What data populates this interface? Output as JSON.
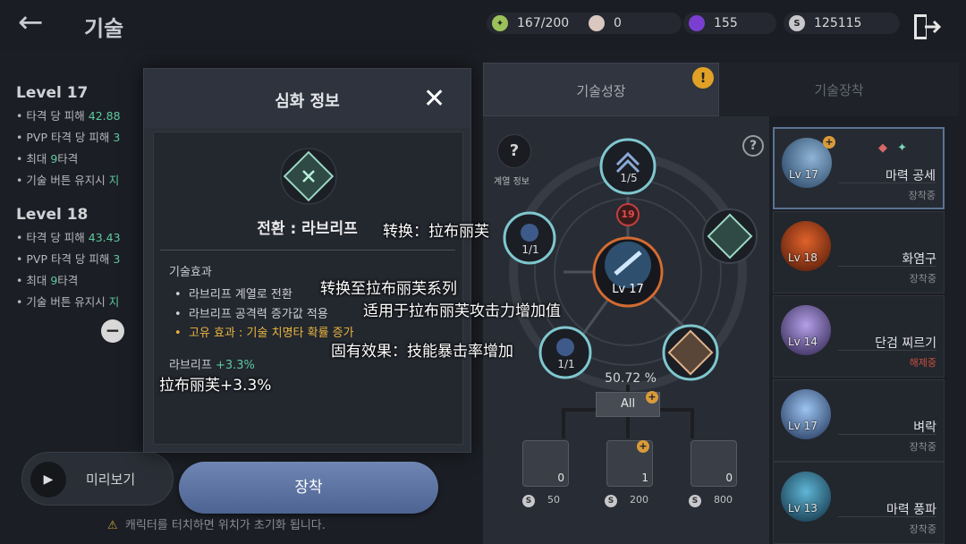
{
  "header": {
    "back_icon": "back-arrow-icon",
    "title": "기술",
    "resources": [
      {
        "icon": "stamina-icon",
        "value": "167/200",
        "color": "#9bc25a"
      },
      {
        "icon": "pearl-icon",
        "value": "0",
        "color": "#d9c7c0"
      },
      {
        "icon": "purple-gem-icon",
        "value": "155",
        "color": "#7a3fd1"
      },
      {
        "icon": "silver-coin-icon",
        "value": "125115",
        "color": "#c8c8cc"
      }
    ],
    "exit_icon": "exit-door-icon"
  },
  "level_info": [
    {
      "title": "Level 17",
      "lines": [
        {
          "label": "타격 당 피해 ",
          "value": "42.88"
        },
        {
          "label": "PVP 타격 당 피해 ",
          "value": "3"
        },
        {
          "label": "최대 ",
          "value": "9",
          "suffix": "타격"
        },
        {
          "label": "기술 버튼 유지시 ",
          "value": "지"
        }
      ]
    },
    {
      "title": "Level 18",
      "lines": [
        {
          "label": "타격 당 피해 ",
          "value": "43.43"
        },
        {
          "label": "PVP 타격 당 피해 ",
          "value": "3"
        },
        {
          "label": "최대 ",
          "value": "9",
          "suffix": "타격"
        },
        {
          "label": "기술 버튼 유지시 ",
          "value": "지"
        }
      ]
    }
  ],
  "preview": {
    "label": "미리보기"
  },
  "reset_hint": "캐릭터를 터치하면 위치가 초기화 됩니다.",
  "modal": {
    "title": "심화 정보",
    "skill_name": "전환 : 라브리프",
    "effect_heading": "기술효과",
    "effects": [
      "라브리프 계열로 전환",
      "라브리프 공격력 증가값 적용",
      "고유 효과 : 기술 치명타 확률 증가"
    ],
    "stat_label": "라브리프 ",
    "stat_value": "+3.3%",
    "equip_label": "장착"
  },
  "translations": [
    "转换：拉布丽芙",
    "转换至拉布丽芙系列",
    "适用于拉布丽芙攻击力增加值",
    "固有效果：技能暴击率增加",
    "拉布丽芙+3.3%"
  ],
  "tabs": [
    {
      "label": "기술성장",
      "active": true
    },
    {
      "label": "기술장착",
      "active": false
    }
  ],
  "alert_badge": "!",
  "tree": {
    "lineage_help": "?",
    "lineage_label": "계열 정보",
    "nodes": {
      "top": "1/5",
      "left": "1/1",
      "bottom_left": "1/1",
      "center_level": "Lv 17",
      "badge": "19"
    },
    "progress": "50.72 %",
    "all_button": "All",
    "books": [
      {
        "count": "0",
        "cost": "50"
      },
      {
        "count": "1",
        "cost": "200"
      },
      {
        "count": "0",
        "cost": "800"
      }
    ],
    "coin_glyph": "S"
  },
  "skills": [
    {
      "level": "Lv 17",
      "name": "마력 공세",
      "state": "장착중",
      "colors": [
        "#1e3a58",
        "#8fb4d6"
      ]
    },
    {
      "level": "Lv 18",
      "name": "화염구",
      "state": "장착중",
      "colors": [
        "#4a1608",
        "#e0622a"
      ]
    },
    {
      "level": "Lv 14",
      "name": "단검 찌르기",
      "state": "해제중",
      "colors": [
        "#2a1f48",
        "#b3a0e8"
      ]
    },
    {
      "level": "Lv 17",
      "name": "벼락",
      "state": "장착중",
      "colors": [
        "#1c2f52",
        "#9cc4f2"
      ]
    },
    {
      "level": "Lv 13",
      "name": "마력 풍파",
      "state": "장착중",
      "colors": [
        "#0e2a3c",
        "#5fb6d6"
      ]
    }
  ]
}
